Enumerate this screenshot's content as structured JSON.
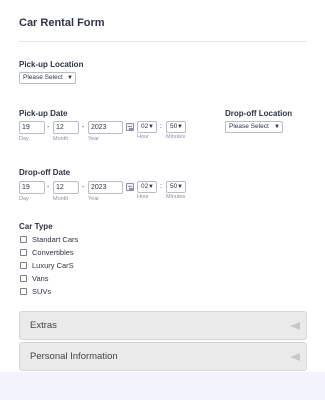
{
  "form": {
    "title": "Car Rental Form"
  },
  "pickup_location": {
    "label": "Pick-up Location",
    "value": "Please Select"
  },
  "pickup_date": {
    "label": "Pick-up Date",
    "day": "19",
    "month": "12",
    "year": "2023",
    "hour": "02",
    "minute": "50",
    "sub_day": "Day",
    "sub_month": "Month",
    "sub_year": "Year",
    "sub_hour": "Hour",
    "sub_minutes": "Minutes",
    "date_sep": "-",
    "time_sep": ":"
  },
  "dropoff_location": {
    "label": "Drop-off Location",
    "value": "Please Select"
  },
  "dropoff_date": {
    "label": "Drop-off Date",
    "day": "19",
    "month": "12",
    "year": "2023",
    "hour": "02",
    "minute": "50",
    "sub_day": "Day",
    "sub_month": "Month",
    "sub_year": "Year",
    "sub_hour": "Hour",
    "sub_minutes": "Minutes",
    "date_sep": "-",
    "time_sep": ":"
  },
  "car_type": {
    "label": "Car Type",
    "options": [
      "Standart Cars",
      "Convertibles",
      "Luxury CarS",
      "Vans",
      "SUVs"
    ]
  },
  "sections": [
    "Extras",
    "Personal Information"
  ],
  "icons": {
    "calendar": "calendar-icon",
    "dropdown": "chevron-down-icon",
    "collapse": "collapse-triangle-icon"
  },
  "colors": {
    "text": "#2c3345",
    "subtext": "#8d8fa8",
    "panel": "#eaeaea",
    "background": "#f3f3fe"
  }
}
